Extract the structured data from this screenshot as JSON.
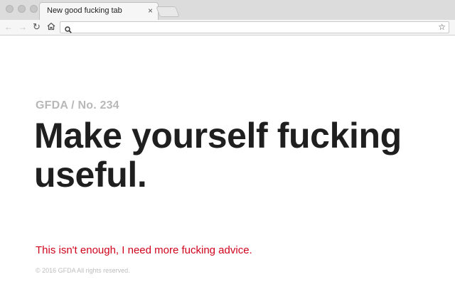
{
  "browser": {
    "tab_title": "New good fucking tab",
    "tab_close_glyph": "×",
    "url": "",
    "icons": [
      "back-arrow-icon",
      "forward-arrow-icon",
      "reload-icon",
      "home-icon",
      "search-icon",
      "star-icon"
    ]
  },
  "page": {
    "issue": "GFDA / No. 234",
    "headline": "Make yourself fucking useful.",
    "advice_link": "This isn't enough, I need more fucking advice.",
    "copyright": "© 2016 GFDA All rights reserved."
  },
  "colors": {
    "headline": "#1f1f1f",
    "issue": "#b8b8b8",
    "link": "#d0021b",
    "copyright": "#bdbdbd"
  }
}
